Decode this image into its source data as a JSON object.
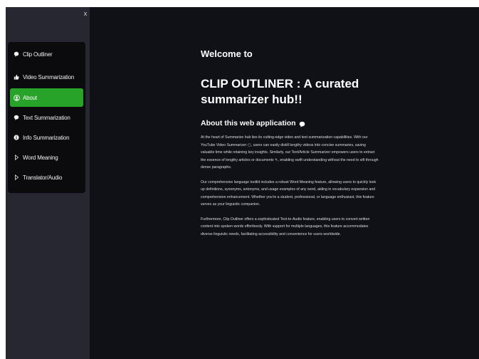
{
  "sidebar": {
    "close_label": "x",
    "items": [
      {
        "label": "Clip Outliner",
        "icon": "chat-bubble-icon"
      },
      {
        "label": "Video Summarization",
        "icon": "thumbs-up-icon"
      },
      {
        "label": "About",
        "icon": "user-circle-icon",
        "active": true
      },
      {
        "label": "Text Summarization",
        "icon": "chat-bubble-icon"
      },
      {
        "label": "Info Summarization",
        "icon": "info-icon"
      },
      {
        "label": "Word Meaning",
        "icon": "caret-right-icon"
      },
      {
        "label": "Translator/Audio",
        "icon": "caret-right-icon"
      }
    ]
  },
  "main": {
    "welcome": "Welcome to",
    "headline": "CLIP OUTLINER : A curated summarizer hub!!",
    "about_heading": "About this web application",
    "paragraphs": [
      "At the heart of Summarize hub lies its cutting-edge video and text summarization capabilities. With our YouTube Video Summarizer ▢, users can easily distill lengthy videos into concise summaries, saving valuable time while retaining key insights. Similarly, our Text/Article Summarizer empowers users to extract the essence of lengthy articles or documents ✎, enabling swift understanding without the need to sift through dense paragraphs.",
      "Our comprehensive language toolkit includes a robust Word Meaning feature, allowing users to quickly look up definitions, synonyms, antonyms, and usage examples of any word, aiding in vocabulary expansion and comprehension enhancement. Whether you're a student, professional, or language enthusiast, this feature serves as your linguistic companion.",
      "Furthermore, Clip Outliner offers a sophisticated Text-to-Audio feature, enabling users to convert written content into spoken words effortlessly. With support for multiple languages, this feature accommodates diverse linguistic needs, facilitating accessibility and convenience for users worldwide."
    ]
  },
  "colors": {
    "main_bg": "#0f1117",
    "sidebar_bg": "#262730",
    "menu_bg": "#0b0b0e",
    "active_item": "#28a32a",
    "text": "#ffffff"
  }
}
